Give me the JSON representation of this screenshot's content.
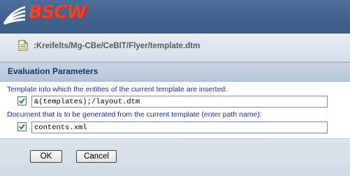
{
  "header": {
    "logo_text": "BSCW"
  },
  "path_bar": {
    "icon": "document-icon",
    "path": ":Kreifelts/Mg-CBe/CeBIT/Flyer/template.dtm"
  },
  "section": {
    "title": "Evaluation Parameters"
  },
  "form": {
    "template_label": "Template into which the entities of the current template are inserted:",
    "template_checked": true,
    "template_value": "&(templates);/layout.dtm",
    "document_label": "Document that is to be generated from the current template (enter path name):",
    "document_checked": true,
    "document_value": "contents.xml"
  },
  "buttons": {
    "ok_label": "OK",
    "cancel_label": "Cancel"
  },
  "colors": {
    "header_bg": "#3f628e",
    "logo": "#e8452a",
    "label": "#1a2ea0",
    "section_title": "#12346b"
  }
}
